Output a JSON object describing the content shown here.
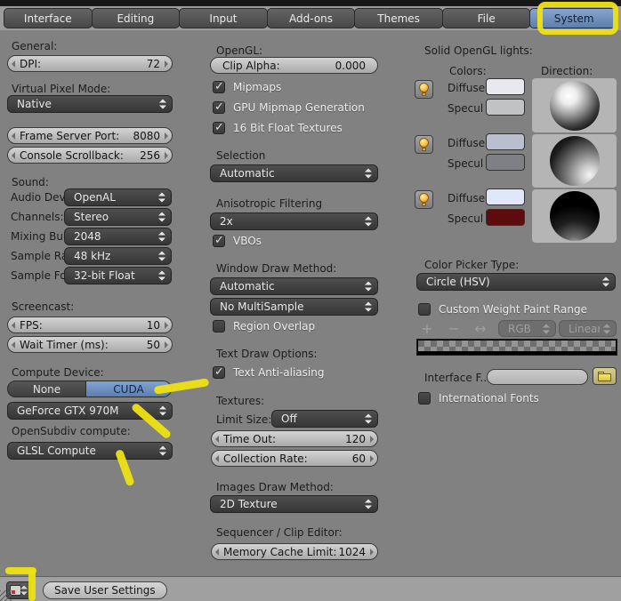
{
  "tabs": {
    "items": [
      {
        "label": "Interface"
      },
      {
        "label": "Editing"
      },
      {
        "label": "Input"
      },
      {
        "label": "Add-ons"
      },
      {
        "label": "Themes"
      },
      {
        "label": "File"
      },
      {
        "label": "System"
      }
    ],
    "active": "System"
  },
  "left": {
    "general_heading": "General:",
    "dpi": {
      "label": "DPI:",
      "value": "72"
    },
    "virtual_pixel_heading": "Virtual Pixel Mode:",
    "virtual_pixel_value": "Native",
    "frame_server_port": {
      "label": "Frame Server Port:",
      "value": "8080"
    },
    "console_scrollback": {
      "label": "Console Scrollback:",
      "value": "256"
    },
    "sound_heading": "Sound:",
    "sound_rows": [
      {
        "label": "Audio Dev",
        "value": "OpenAL"
      },
      {
        "label": "Channels:",
        "value": "Stereo"
      },
      {
        "label": "Mixing Bu",
        "value": "2048"
      },
      {
        "label": "Sample Ra",
        "value": "48 kHz"
      },
      {
        "label": "Sample Fo",
        "value": "32-bit Float"
      }
    ],
    "screencast_heading": "Screencast:",
    "fps": {
      "label": "FPS:",
      "value": "10"
    },
    "wait_timer": {
      "label": "Wait Timer (ms):",
      "value": "50"
    },
    "compute_heading": "Compute Device:",
    "compute_none": "None",
    "compute_cuda": "CUDA",
    "compute_device_value": "GeForce GTX 970M",
    "opensubdiv_heading": "OpenSubdiv compute:",
    "opensubdiv_value": "GLSL Compute"
  },
  "middle": {
    "opengl_heading": "OpenGL:",
    "clip_alpha": {
      "label": "Clip Alpha:",
      "value": "0.000"
    },
    "mipmaps": {
      "label": "Mipmaps",
      "checked": true
    },
    "gpu_mipmap": {
      "label": "GPU Mipmap Generation",
      "checked": true
    },
    "float_textures": {
      "label": "16 Bit Float Textures",
      "checked": true
    },
    "selection_heading": "Selection",
    "selection_value": "Automatic",
    "aniso_heading": "Anisotropic Filtering",
    "aniso_value": "2x",
    "vbos": {
      "label": "VBOs",
      "checked": true
    },
    "window_draw_heading": "Window Draw Method:",
    "window_draw_value": "Automatic",
    "multisample_value": "No MultiSample",
    "region_overlap": {
      "label": "Region Overlap",
      "checked": false
    },
    "text_draw_heading": "Text Draw Options:",
    "text_aa": {
      "label": "Text Anti-aliasing",
      "checked": true
    },
    "textures_heading": "Textures:",
    "limit_size_label": "Limit Size:",
    "limit_size_value": "Off",
    "time_out": {
      "label": "Time Out:",
      "value": "120"
    },
    "collection_rate": {
      "label": "Collection Rate:",
      "value": "60"
    },
    "images_heading": "Images Draw Method:",
    "images_value": "2D Texture",
    "sequencer_heading": "Sequencer / Clip Editor:",
    "memory_cache": {
      "label": "Memory Cache Limit:",
      "value": "1024"
    }
  },
  "right": {
    "lights_heading": "Solid OpenGL lights:",
    "colors_label": "Colors:",
    "direction_label": "Direction:",
    "diffuse_label": "Diffuse",
    "specular_label": "Specul",
    "lights": [
      {
        "diffuse": "#e7e9ef",
        "specular": "#c0c2c4"
      },
      {
        "diffuse": "#babecf",
        "specular": "#7e8085"
      },
      {
        "diffuse": "#e0e7fb",
        "specular": "#5d0b0b"
      }
    ],
    "picker_heading": "Color Picker Type:",
    "picker_value": "Circle (HSV)",
    "weight_paint": {
      "label": "Custom Weight Paint Range",
      "checked": false
    },
    "ramp": {
      "add": "+",
      "remove": "−",
      "flip": "↔",
      "color_mode": "RGB",
      "interpolation": "Linear"
    },
    "interface_font_label": "Interface F...",
    "interface_font_value": "",
    "international_fonts": {
      "label": "International Fonts",
      "checked": false
    }
  },
  "footer": {
    "save_button": "Save User Settings"
  },
  "colors": {
    "tab_active": "#6d92c3",
    "cuda_active": "#6d92c3",
    "annotation": "#eee214",
    "specular_red": "#5d0b0b"
  }
}
